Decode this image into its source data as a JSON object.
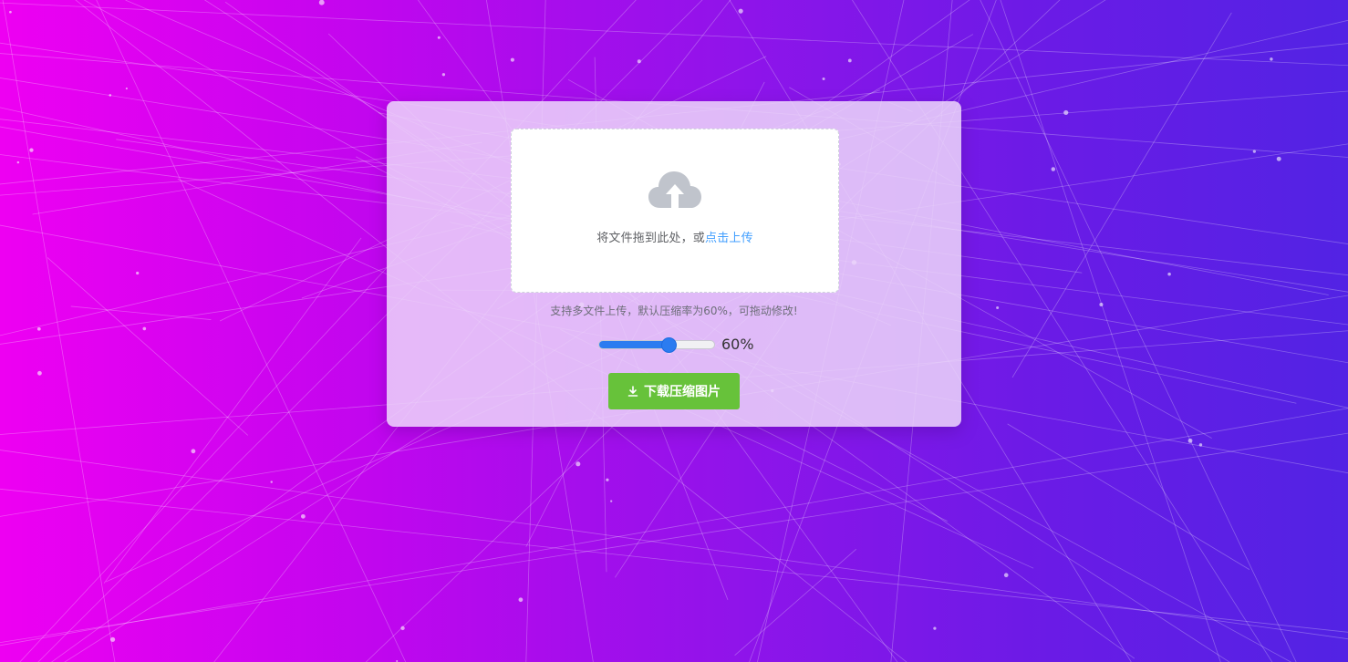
{
  "upload": {
    "drag_text": "将文件拖到此处，或",
    "click_text": "点击上传",
    "icon": "cloud-upload-icon"
  },
  "tip": "支持多文件上传，默认压缩率为60%，可拖动修改!",
  "compression": {
    "value": 60,
    "max": 100,
    "display": "60%"
  },
  "download": {
    "label": "下载压缩图片",
    "icon": "download-icon"
  },
  "colors": {
    "accent": "#409eff",
    "slider": "#2b7cf0",
    "button": "#67c23a"
  }
}
